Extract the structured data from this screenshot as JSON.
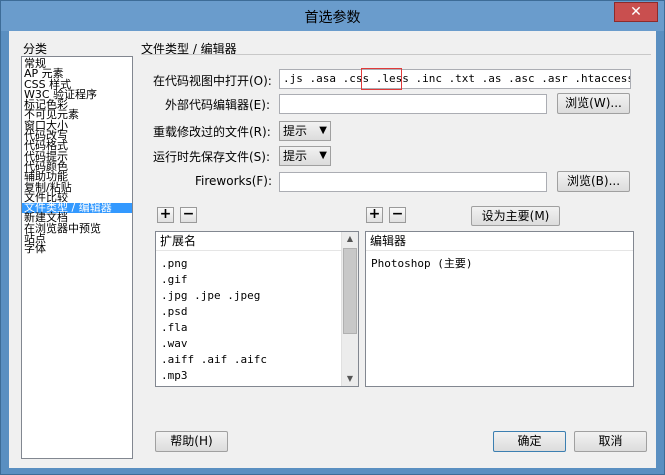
{
  "window": {
    "title": "首选参数",
    "close_glyph": "✕"
  },
  "sidebar": {
    "heading": "分类",
    "items": [
      "常规",
      "AP 元素",
      "CSS 样式",
      "W3C 验证程序",
      "标记色彩",
      "不可见元素",
      "窗口大小",
      "代码改写",
      "代码格式",
      "代码提示",
      "代码颜色",
      "辅助功能",
      "复制/粘贴",
      "文件比较",
      "文件类型 / 编辑器",
      "新建文档",
      "在浏览器中预览",
      "站点",
      "字体"
    ],
    "selected_index": 14
  },
  "panel": {
    "title": "文件类型 / 编辑器",
    "open_in_code_label": "在代码视图中打开(O):",
    "open_in_code_value": ".js .asa .css .less .inc .txt .as .asc .asr .htaccess .htp",
    "highlighted_token": ".less",
    "external_editor_label": "外部代码编辑器(E):",
    "external_editor_value": "",
    "browse1_label": "浏览(W)...",
    "reload_label": "重载修改过的文件(R):",
    "reload_value": "提示",
    "save_on_start_label": "运行时先保存文件(S):",
    "save_on_start_value": "提示",
    "fireworks_label": "Fireworks(F):",
    "fireworks_value": "",
    "browse2_label": "浏览(B)...",
    "plus": "+",
    "minus": "−",
    "set_primary_label": "设为主要(M)",
    "extensions_header": "扩展名",
    "extensions": [
      ".png",
      ".gif",
      ".jpg .jpe .jpeg",
      ".psd",
      ".fla",
      ".wav",
      ".aiff .aif .aifc",
      ".mp3"
    ],
    "editors_header": "编辑器",
    "editors": [
      "Photoshop (主要)"
    ]
  },
  "footer": {
    "help_label": "帮助(H)",
    "ok_label": "确定",
    "cancel_label": "取消"
  },
  "colors": {
    "titlebar": "#6a9ccc",
    "selection": "#3399ff",
    "highlight_box": "#e03a3a",
    "close": "#c94f4f"
  }
}
